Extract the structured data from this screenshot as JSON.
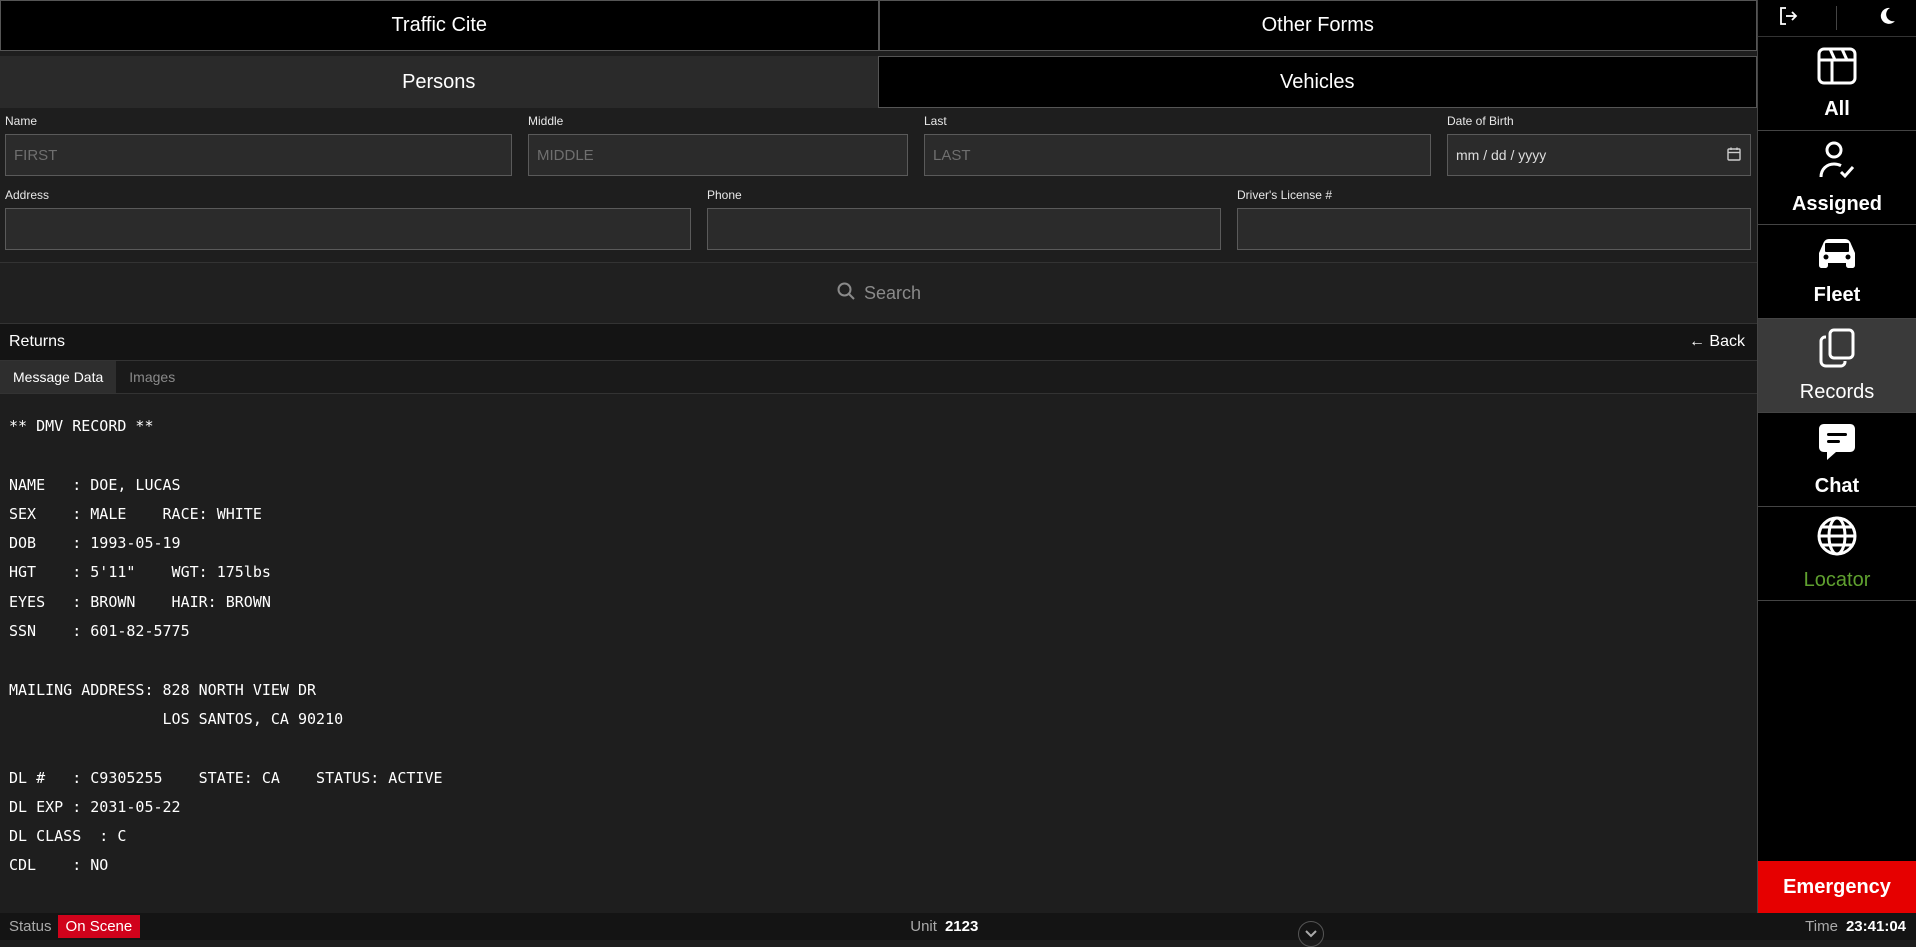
{
  "tabs": {
    "traffic_cite": "Traffic Cite",
    "other_forms": "Other Forms",
    "persons": "Persons",
    "vehicles": "Vehicles"
  },
  "form": {
    "name_label": "Name",
    "name_placeholder": "FIRST",
    "middle_label": "Middle",
    "middle_placeholder": "MIDDLE",
    "last_label": "Last",
    "last_placeholder": "LAST",
    "dob_label": "Date of Birth",
    "dob_placeholder": "mm / dd / yyyy",
    "address_label": "Address",
    "phone_label": "Phone",
    "dl_label": "Driver's License #",
    "search_label": "Search"
  },
  "returns": {
    "title": "Returns",
    "back": "← Back",
    "tab_message": "Message Data",
    "tab_images": "Images"
  },
  "record_text": "** DMV RECORD **\n\nNAME   : DOE, LUCAS\nSEX    : MALE    RACE: WHITE\nDOB    : 1993-05-19\nHGT    : 5'11\"    WGT: 175lbs\nEYES   : BROWN    HAIR: BROWN\nSSN    : 601-82-5775\n\nMAILING ADDRESS: 828 NORTH VIEW DR\n                 LOS SANTOS, CA 90210\n\nDL #   : C9305255    STATE: CA    STATUS: ACTIVE\nDL EXP : 2031-05-22\nDL CLASS  : C\nCDL    : NO",
  "sidebar": {
    "items": [
      {
        "label": "All",
        "icon": "layout-icon"
      },
      {
        "label": "Assigned",
        "icon": "user-check-icon"
      },
      {
        "label": "Fleet",
        "icon": "car-icon"
      },
      {
        "label": "Records",
        "icon": "copy-icon"
      },
      {
        "label": "Chat",
        "icon": "chat-icon"
      },
      {
        "label": "Locator",
        "icon": "globe-icon"
      }
    ],
    "emergency": "Emergency"
  },
  "status": {
    "status_label": "Status",
    "status_value": "On Scene",
    "unit_label": "Unit",
    "unit_value": "2123",
    "time_label": "Time",
    "time_value": "23:41:04"
  },
  "colors": {
    "emergency": "#e60000",
    "status_badge": "#d0021b",
    "locator": "#5fa02f"
  }
}
